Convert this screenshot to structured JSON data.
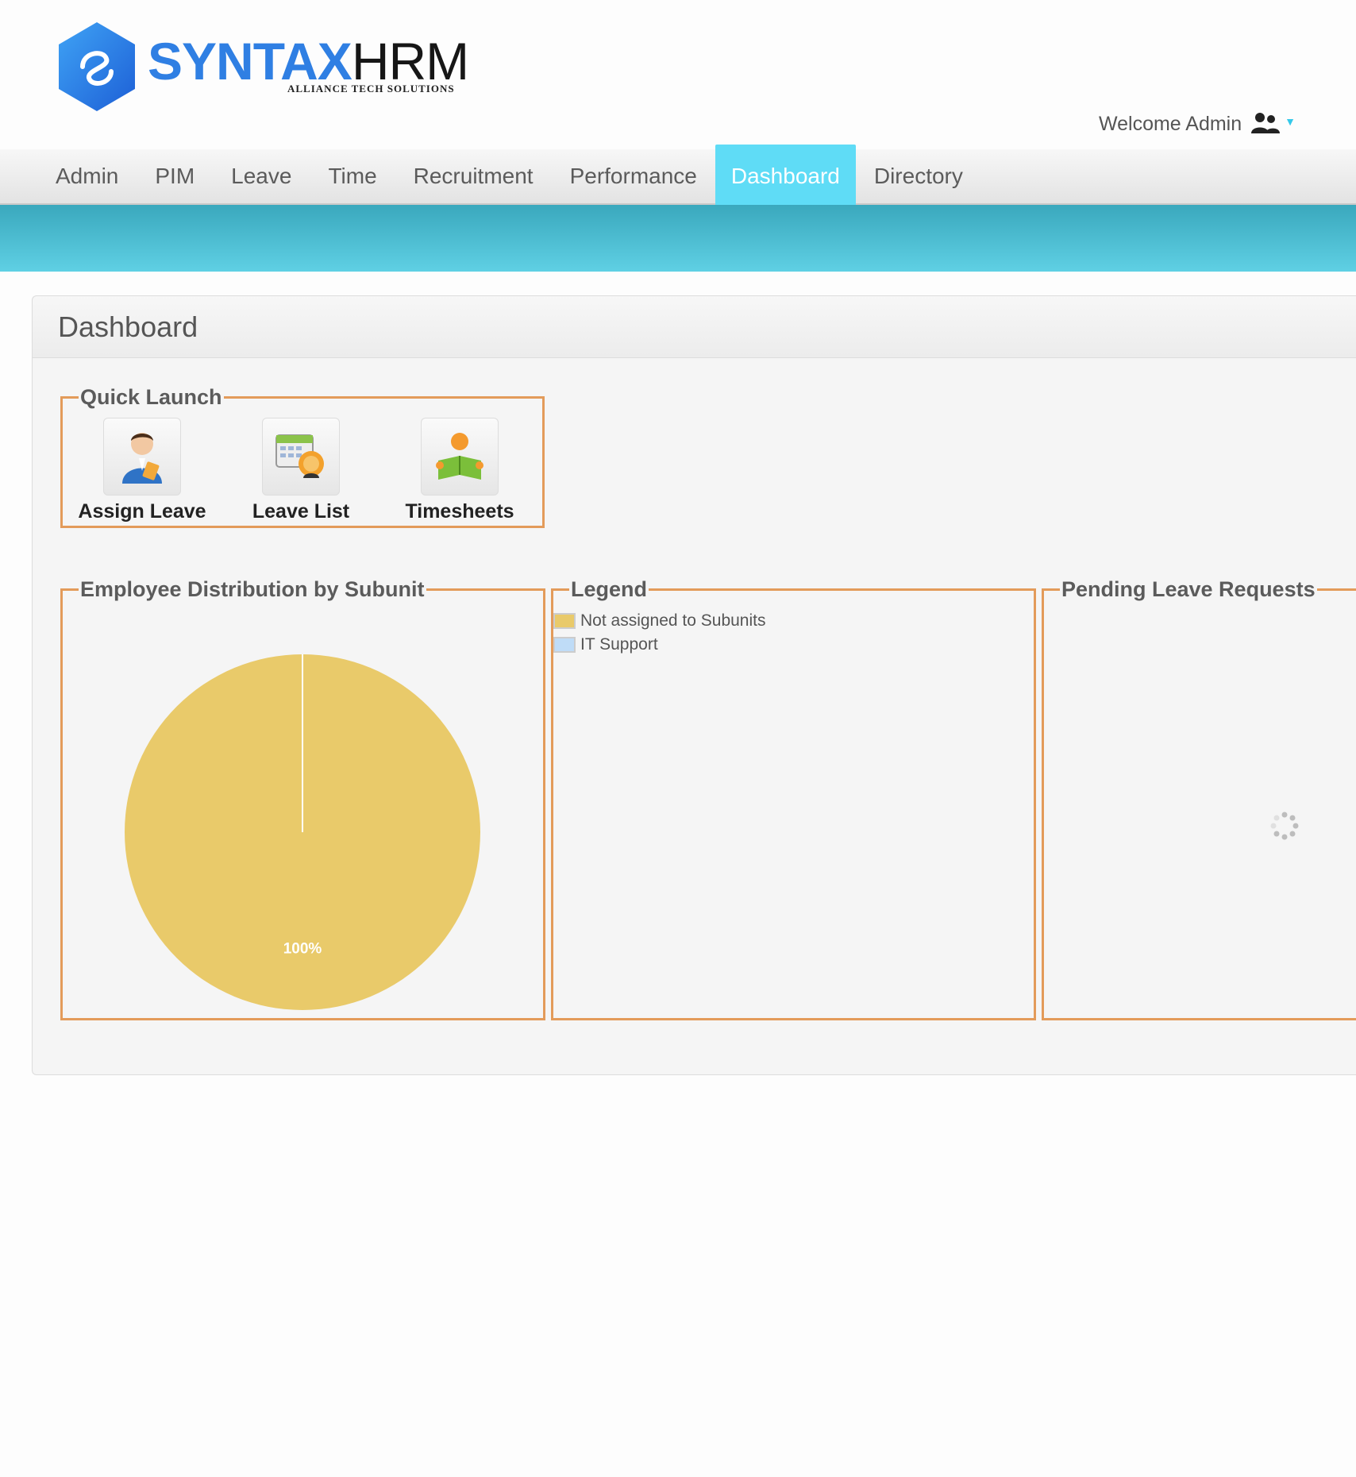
{
  "header": {
    "brand_part1": "SYNTAX",
    "brand_part2": "HRM",
    "tagline": "ALLIANCE TECH SOLUTIONS",
    "welcome": "Welcome Admin",
    "user_icon": "users-icon"
  },
  "menu": {
    "items": [
      "Admin",
      "PIM",
      "Leave",
      "Time",
      "Recruitment",
      "Performance",
      "Dashboard",
      "Directory"
    ],
    "active": "Dashboard"
  },
  "page": {
    "title": "Dashboard"
  },
  "quick_launch": {
    "title": "Quick Launch",
    "items": [
      {
        "label": "Assign Leave",
        "icon": "assign-leave-icon"
      },
      {
        "label": "Leave List",
        "icon": "leave-list-icon"
      },
      {
        "label": "Timesheets",
        "icon": "timesheets-icon"
      }
    ]
  },
  "distribution": {
    "title": "Employee Distribution by Subunit",
    "slice_label": "100%"
  },
  "chart_data": {
    "type": "pie",
    "categories": [
      "Not assigned to Subunits",
      "IT Support"
    ],
    "values": [
      100,
      0
    ],
    "data_labels": [
      "100%"
    ],
    "colors": [
      "#e9ca6a",
      "#bfdcf7"
    ],
    "legend_placement": "separate panel"
  },
  "legend": {
    "title": "Legend",
    "items": [
      {
        "label": "Not assigned to Subunits",
        "color": "#e9ca6a"
      },
      {
        "label": "IT Support",
        "color": "#bfdcf7"
      }
    ]
  },
  "pending": {
    "title": "Pending Leave Requests"
  },
  "colors": {
    "accent": "#5fdcf6",
    "banner": "#4bbfd5",
    "fieldset_border": "#e39b5a",
    "brand_blue": "#2f7fe3"
  }
}
